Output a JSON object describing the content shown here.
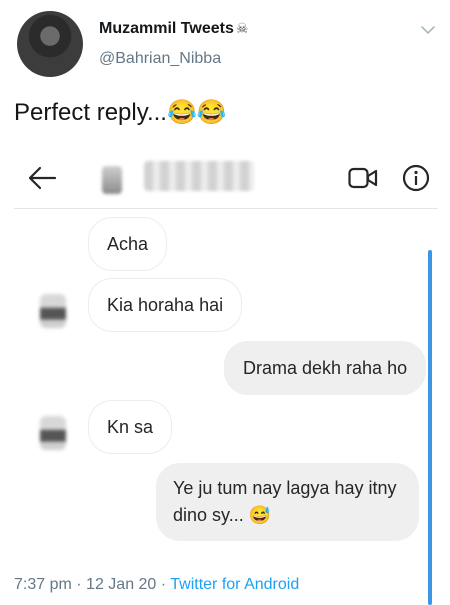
{
  "tweet": {
    "author_name": "Muzammil Tweets",
    "author_emoji": "☠",
    "handle": "@Bahrian_Nibba",
    "text": "Perfect reply...😂😂",
    "time": "7:37 pm",
    "date": "12 Jan 20",
    "source": "Twitter for Android"
  },
  "dm": {
    "messages": [
      {
        "side": "received",
        "text": "Acha",
        "avatar": false
      },
      {
        "side": "received",
        "text": "Kia horaha hai",
        "avatar": true
      },
      {
        "side": "sent",
        "text": "Drama dekh raha ho"
      },
      {
        "side": "received",
        "text": "Kn sa",
        "avatar": true
      },
      {
        "side": "sent",
        "line1": "Ye ju tum nay lagya hay itny",
        "line2": "dino sy... 😅"
      }
    ]
  },
  "colors": {
    "link": "#1da1f2",
    "muted": "#657786",
    "scrollbar": "#3b97e3"
  },
  "icons": [
    "back-arrow-icon",
    "video-call-icon",
    "info-icon",
    "chevron-down-icon"
  ]
}
